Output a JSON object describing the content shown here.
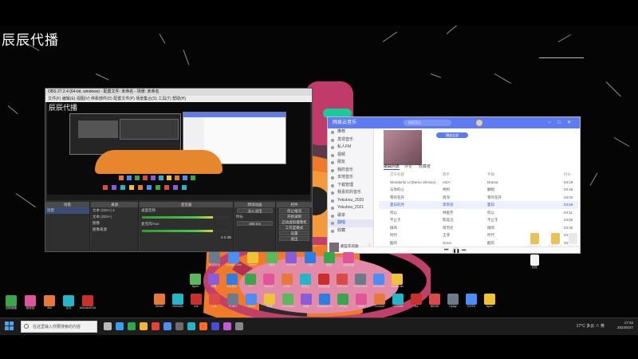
{
  "overlay": {
    "title": "辰辰代播"
  },
  "obs": {
    "titlebar": "OBS 27.2.4 (64-bit, windows) - 配置文件: 未命名 - 场景: 未命名",
    "menu": "文件(F)  编辑(E)  视图(V)  停靠部件(D)  配置文件(P)  场景集合(S)  工具(T)  帮助(H)",
    "preview_title": "辰辰代播",
    "docks": {
      "scenes_head": "场景",
      "scene_item": "场景",
      "sources_head": "来源",
      "sources": [
        "文本 (GDI+) 2",
        "文本 (GDI+)",
        "图像",
        "图像来源"
      ],
      "mixer_head": "混音器",
      "mixer_a": "桌面音频",
      "mixer_b": "麦克风/Aux",
      "mixer_db": "0.0 dB",
      "transitions_head": "转场动画",
      "transition_value": "淡入淡出",
      "duration_label": "时长",
      "duration_value": "300 ms",
      "controls_head": "控件",
      "controls": [
        "停止推流",
        "开始录制",
        "启动虚拟摄像机",
        "工作室模式",
        "设置",
        "退出"
      ]
    }
  },
  "music": {
    "app_name": "网易云音乐",
    "search_placeholder": "搜索音乐",
    "sidebar": [
      "推荐",
      "发现音乐",
      "私人FM",
      "视频",
      "朋友",
      "我的音乐",
      "本地音乐",
      "下载管理",
      "我喜欢的音乐",
      "Yokubou_2020",
      "Yokubou_2021",
      "歌单",
      "翻唱",
      "收藏"
    ],
    "sidebar_active_index": 12,
    "playlist_play": "播放全部",
    "tabs": [
      "歌曲列表",
      "评论",
      "收藏者"
    ],
    "headers": [
      "音乐标题",
      "歌手",
      "专辑",
      "时长"
    ],
    "rows": [
      [
        "Wonderful U (Demo Version)",
        "AGA",
        "Drama",
        "04:19"
      ],
      [
        "与你的心",
        "柯柯",
        "翻唱",
        "03:45"
      ],
      [
        "零的花开",
        "周深",
        "零的花开",
        "04:02"
      ],
      [
        "夏日的月",
        "李荣浩",
        "夏日",
        "03:58"
      ],
      [
        "何以",
        "林俊杰",
        "何以",
        "04:11"
      ],
      [
        "不止于",
        "陈奕迅",
        "不止于",
        "04:05"
      ],
      [
        "微风",
        "周杰伦",
        "微风",
        "03:30"
      ],
      [
        "时代",
        "王菲",
        "时代",
        "04:27"
      ],
      [
        "酷的",
        "Gooo",
        "酷的",
        "03:40"
      ],
      [
        "Way Wait Radio Remix",
        "Various",
        "Way Wait Remix",
        "03:20"
      ]
    ],
    "highlight_row": 3,
    "now_playing": "那些年的歌"
  },
  "desktop_icons": {
    "left_dock": [
      "控制面板",
      "回收站",
      "360",
      "文件",
      "Microsoft Edge"
    ],
    "grid_row1": [
      "火绒安全",
      "Google Chrome",
      "Steam",
      "搜狗",
      "Discord",
      "QQ",
      "微信",
      "百度网盘"
    ],
    "grid_row2": [
      "Apex",
      "网易",
      "QQ音乐",
      "YY",
      "Discord",
      "LINE",
      "网易云",
      "英雄联盟",
      "VSCode",
      "RGB Flash",
      "WeGame",
      "Battle.net"
    ],
    "grid_row3": [
      "Steam",
      "Genshin",
      "Ark",
      "LOL",
      "PUBG",
      "Twitch",
      "哔哩",
      "Overwatch",
      "网易",
      "Wallpaper Engine",
      "UPlay",
      "Epic",
      "Chrome",
      "VSCode",
      "EA",
      "NIKKE",
      "Uplay",
      "DOTA",
      "Apex"
    ],
    "right_files": [
      "新建文件夹",
      "新建文件夹",
      "Chapter v4_1.pdf",
      "文档"
    ]
  },
  "taskbar": {
    "search_placeholder": "在这里输入你要搜索的内容",
    "tray_text": "17°C 多云 ∧ 英",
    "time": "17:32",
    "date": "2022/5/27"
  }
}
